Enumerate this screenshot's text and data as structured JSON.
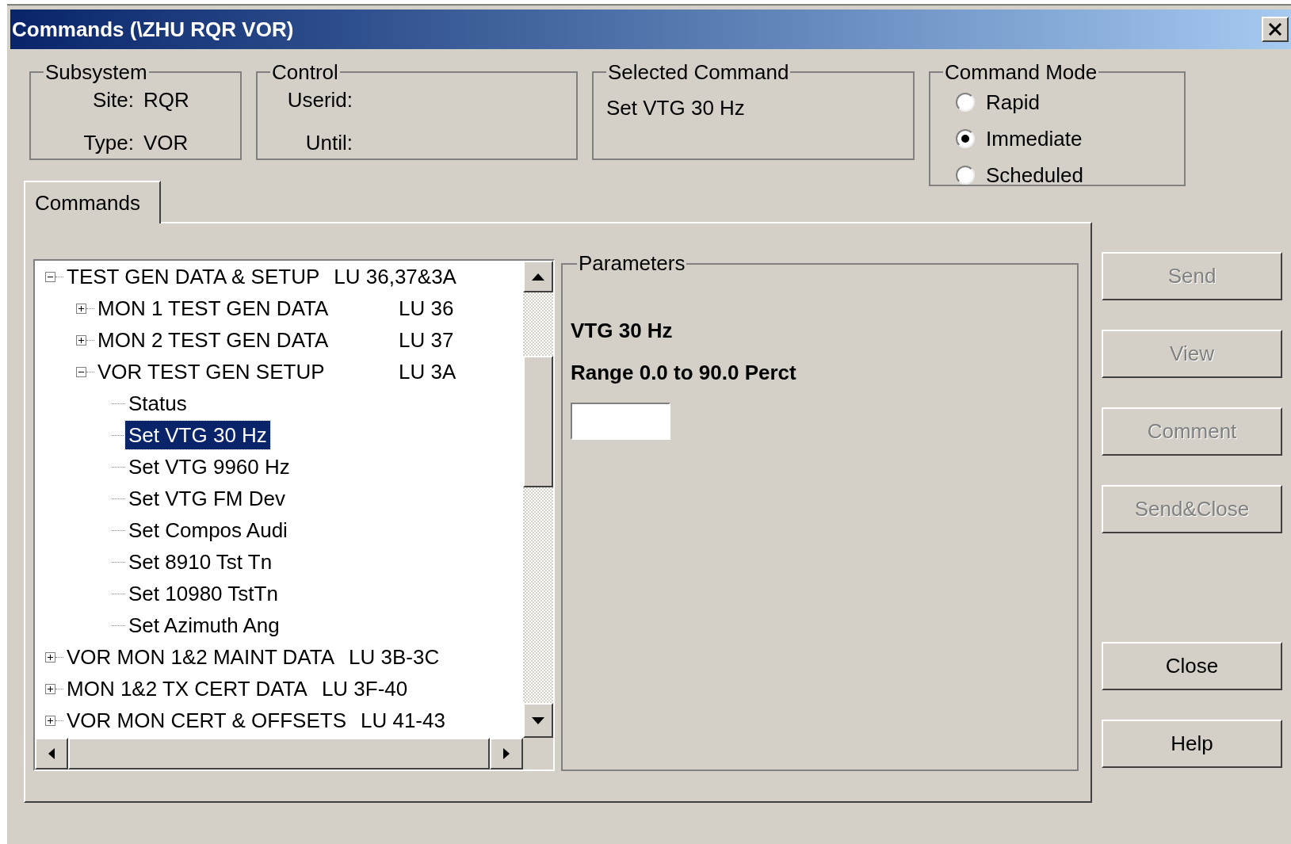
{
  "window": {
    "title": "Commands (\\ZHU RQR VOR)"
  },
  "subsystem": {
    "legend": "Subsystem",
    "fields": [
      {
        "label": "Site:",
        "value": "RQR"
      },
      {
        "label": "Type:",
        "value": "VOR"
      }
    ]
  },
  "control": {
    "legend": "Control",
    "fields": [
      {
        "label": "Userid:"
      },
      {
        "label": "Until:"
      }
    ]
  },
  "selected_command": {
    "legend": "Selected Command",
    "value": "Set VTG 30 Hz"
  },
  "command_mode": {
    "legend": "Command Mode",
    "options": [
      {
        "label": "Rapid",
        "selected": false
      },
      {
        "label": "Immediate",
        "selected": true
      },
      {
        "label": "Scheduled",
        "selected": false
      }
    ]
  },
  "tabs": [
    {
      "label": "Commands",
      "selected": true
    }
  ],
  "tree": [
    {
      "label": "TEST GEN DATA & SETUP",
      "lu": "LU 36,37&3A",
      "expanded": true,
      "selected": false,
      "children": [
        {
          "label": "MON 1 TEST GEN DATA",
          "lu": "LU 36",
          "expanded": false,
          "selected": false
        },
        {
          "label": "MON 2 TEST GEN DATA",
          "lu": "LU 37",
          "expanded": false,
          "selected": false
        },
        {
          "label": "VOR TEST GEN SETUP",
          "lu": "LU 3A",
          "expanded": true,
          "selected": false,
          "children": [
            {
              "label": "Status",
              "selected": false
            },
            {
              "label": "Set VTG 30 Hz",
              "selected": true
            },
            {
              "label": "Set VTG 9960 Hz",
              "selected": false
            },
            {
              "label": "Set VTG FM Dev",
              "selected": false
            },
            {
              "label": "Set Compos Audi",
              "selected": false
            },
            {
              "label": "Set 8910 Tst Tn",
              "selected": false
            },
            {
              "label": "Set 10980 TstTn",
              "selected": false
            },
            {
              "label": "Set Azimuth Ang",
              "selected": false
            }
          ]
        }
      ]
    },
    {
      "label": "VOR MON 1&2 MAINT DATA",
      "lu": "LU 3B-3C",
      "expanded": false,
      "selected": false
    },
    {
      "label": "MON 1&2 TX CERT DATA",
      "lu": "LU 3F-40",
      "expanded": false,
      "selected": false
    },
    {
      "label": "VOR MON CERT & OFFSETS",
      "lu": "LU 41-43",
      "expanded": false,
      "selected": false
    }
  ],
  "parameters": {
    "legend": "Parameters",
    "name": "VTG 30 Hz",
    "range": "Range 0.0 to 90.0 Perct"
  },
  "buttons": [
    {
      "label": "Send",
      "disabled": true
    },
    {
      "label": "View",
      "disabled": true
    },
    {
      "label": "Comment",
      "disabled": true
    },
    {
      "label": "Send&Close",
      "disabled": true
    },
    {
      "label": "Close",
      "disabled": false
    },
    {
      "label": "Help",
      "disabled": false
    }
  ]
}
